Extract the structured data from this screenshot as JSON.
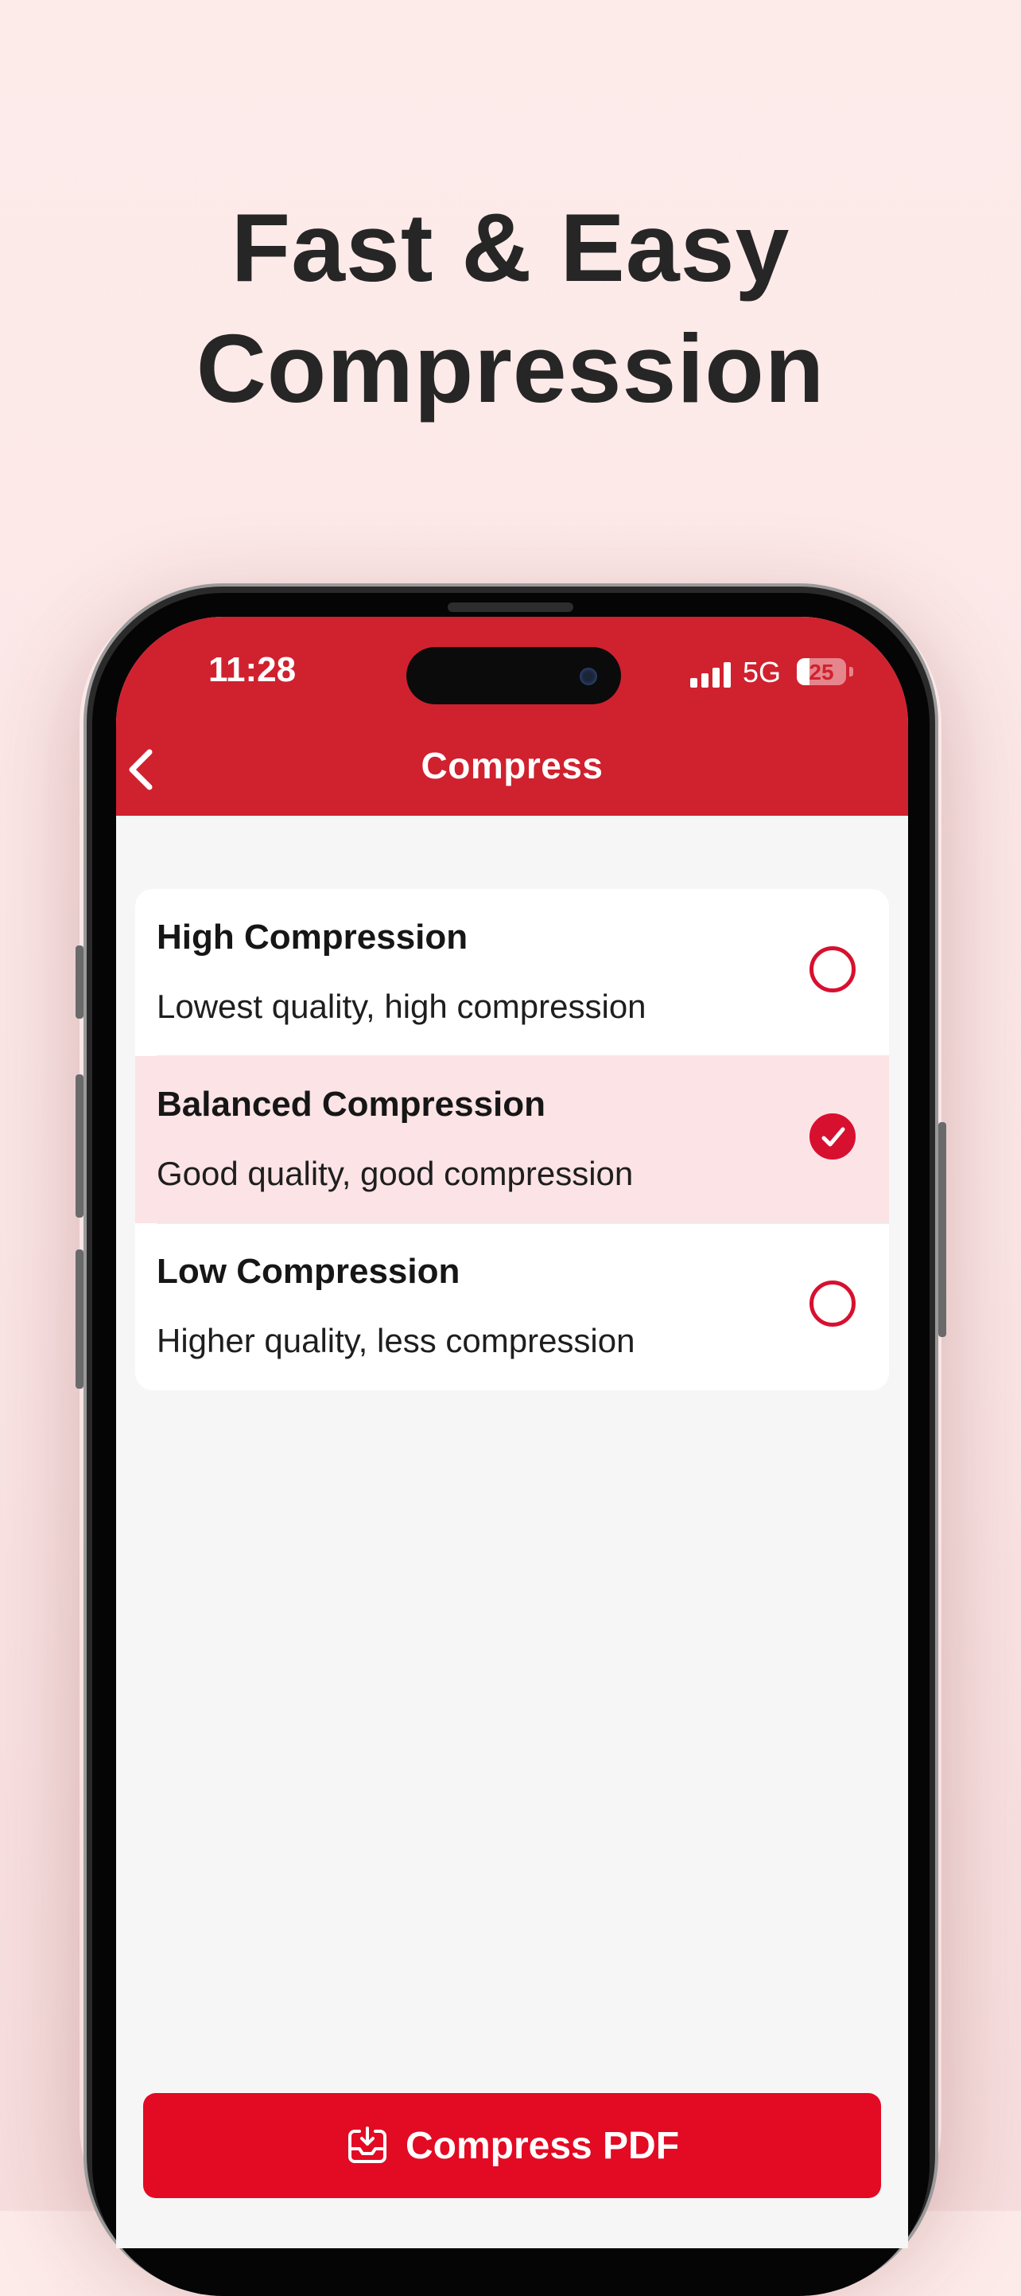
{
  "headline": {
    "line1": "Fast & Easy",
    "line2": "Compression"
  },
  "status_bar": {
    "time": "11:28",
    "network": "5G",
    "battery": "25",
    "battery_level": 0.25
  },
  "app_bar": {
    "title": "Compress",
    "back_icon": "chevron-left-icon"
  },
  "options": [
    {
      "title": "High Compression",
      "description": "Lowest quality, high compression",
      "selected": false
    },
    {
      "title": "Balanced Compression",
      "description": "Good quality, good compression",
      "selected": true
    },
    {
      "title": "Low Compression",
      "description": "Higher quality, less compression",
      "selected": false
    }
  ],
  "action": {
    "label": "Compress PDF",
    "icon": "download-tray-icon"
  },
  "colors": {
    "accent": "#d0212f",
    "button": "#e30a24",
    "selected_row": "#fbe3e6",
    "background": "#fdebea"
  }
}
